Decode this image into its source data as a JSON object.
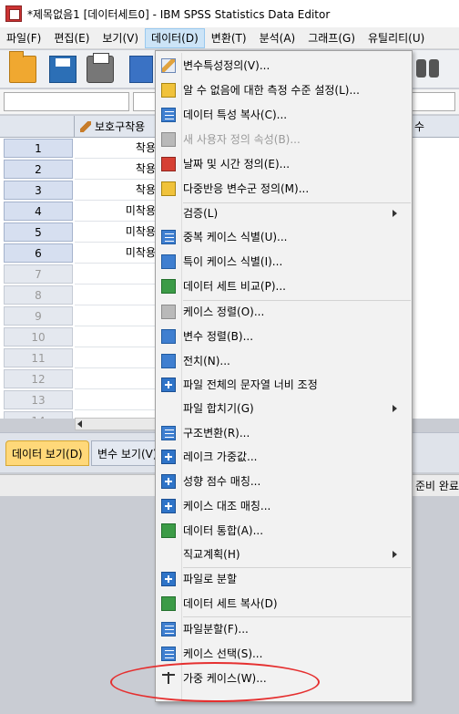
{
  "window": {
    "title": "*제목없음1 [데이터세트0] - IBM SPSS Statistics Data Editor"
  },
  "menubar": {
    "items": [
      {
        "label": "파일(F)"
      },
      {
        "label": "편집(E)"
      },
      {
        "label": "보기(V)"
      },
      {
        "label": "데이터(D)"
      },
      {
        "label": "변환(T)"
      },
      {
        "label": "분석(A)"
      },
      {
        "label": "그래프(G)"
      },
      {
        "label": "유틸리티(U)"
      }
    ]
  },
  "grid": {
    "column_header": "보호구착용",
    "right_header": "수",
    "rows": [
      {
        "num": "1",
        "value": "착용"
      },
      {
        "num": "2",
        "value": "착용"
      },
      {
        "num": "3",
        "value": "착용"
      },
      {
        "num": "4",
        "value": "미착용"
      },
      {
        "num": "5",
        "value": "미착용"
      },
      {
        "num": "6",
        "value": "미착용"
      },
      {
        "num": "7",
        "value": ""
      },
      {
        "num": "8",
        "value": ""
      },
      {
        "num": "9",
        "value": ""
      },
      {
        "num": "10",
        "value": ""
      },
      {
        "num": "11",
        "value": ""
      },
      {
        "num": "12",
        "value": ""
      },
      {
        "num": "13",
        "value": ""
      },
      {
        "num": "14",
        "value": ""
      }
    ]
  },
  "tabs": {
    "data_view": "데이터 보기(D)",
    "variable_view": "변수 보기(V)"
  },
  "status": {
    "text": "준비 완료"
  },
  "data_menu": {
    "items": [
      {
        "label": "변수특성정의(V)...",
        "icon": "define-properties-icon"
      },
      {
        "label": "알 수 없음에 대한 측정 수준 설정(L)...",
        "icon": "measurement-level-icon"
      },
      {
        "label": "데이터 특성 복사(C)...",
        "icon": "copy-properties-icon"
      },
      {
        "label": "새 사용자 정의 속성(B)...",
        "icon": "custom-attribute-icon",
        "disabled": true
      },
      {
        "label": "날짜 및 시간 정의(E)...",
        "icon": "date-time-icon"
      },
      {
        "label": "다중반응 변수군 정의(M)...",
        "icon": "multiple-response-icon"
      },
      {
        "label": "검증(L)",
        "submenu": true
      },
      {
        "label": "중복 케이스 식별(U)...",
        "icon": "duplicate-cases-icon"
      },
      {
        "label": "특이 케이스 식별(I)...",
        "icon": "unusual-cases-icon"
      },
      {
        "label": "데이터 세트 비교(P)...",
        "icon": "compare-datasets-icon"
      },
      {
        "label": "케이스 정렬(O)...",
        "icon": "sort-cases-icon"
      },
      {
        "label": "변수 정렬(B)...",
        "icon": "sort-variables-icon"
      },
      {
        "label": "전치(N)...",
        "icon": "transpose-icon"
      },
      {
        "label": "파일 전체의 문자열 너비 조정",
        "icon": "string-width-icon"
      },
      {
        "label": "파일 합치기(G)",
        "submenu": true
      },
      {
        "label": "구조변환(R)...",
        "icon": "restructure-icon"
      },
      {
        "label": "레이크 가중값...",
        "icon": "rake-weights-icon"
      },
      {
        "label": "성향 점수 매칭...",
        "icon": "propensity-matching-icon"
      },
      {
        "label": "케이스 대조 매칭...",
        "icon": "case-control-icon"
      },
      {
        "label": "데이터 통합(A)...",
        "icon": "aggregate-icon"
      },
      {
        "label": "직교계획(H)",
        "submenu": true
      },
      {
        "label": "파일로 분할",
        "icon": "split-to-files-icon"
      },
      {
        "label": "데이터 세트 복사(D)",
        "icon": "copy-dataset-icon"
      },
      {
        "label": "파일분할(F)...",
        "icon": "split-file-icon"
      },
      {
        "label": "케이스 선택(S)...",
        "icon": "select-cases-icon"
      },
      {
        "label": "가중 케이스(W)...",
        "icon": "weight-cases-icon"
      }
    ]
  }
}
